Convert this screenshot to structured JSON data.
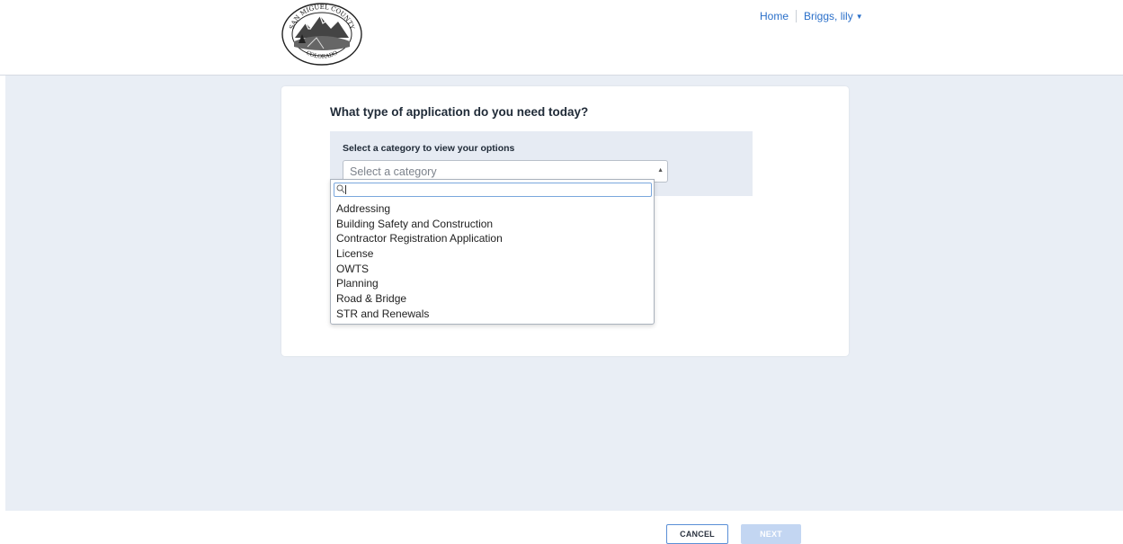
{
  "header": {
    "seal": {
      "top_text": "SAN MIGUEL COUNTY",
      "bottom_text": "COLORADO"
    },
    "nav": {
      "home_label": "Home",
      "user_label": "Briggs, lily"
    }
  },
  "main": {
    "question": "What type of application do you need today?",
    "category_label": "Select a category to view your options",
    "category_select": {
      "placeholder": "Select a category"
    },
    "dropdown": {
      "search_value": "",
      "options": [
        "Addressing",
        "Building Safety and Construction",
        "Contractor Registration Application",
        "License",
        "OWTS",
        "Planning",
        "Road & Bridge",
        "STR and Renewals"
      ]
    }
  },
  "footer": {
    "cancel_label": "CANCEL",
    "next_label": "NEXT"
  },
  "colors": {
    "link": "#2a6fc9",
    "page_bg": "#e9eef5",
    "next_disabled": "#c3d6f2"
  }
}
